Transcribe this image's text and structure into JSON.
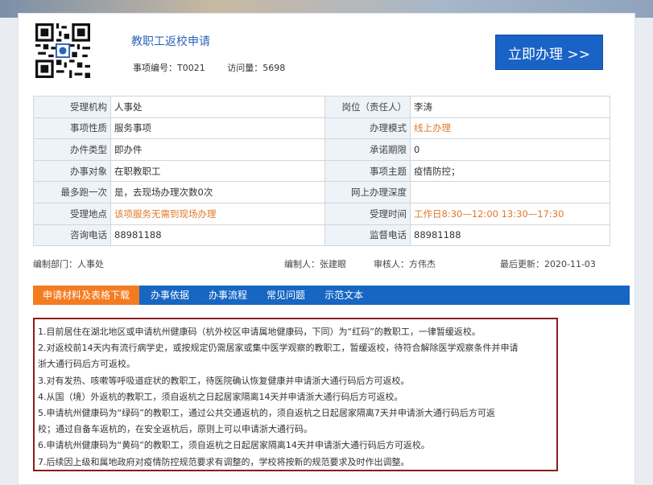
{
  "header": {
    "title": "教职工返校申请",
    "item_no": "事项编号：T0021",
    "visits": "访问量：5698",
    "apply_button": "立即办理 >>"
  },
  "colors": {
    "accent": "#1a63c6",
    "orange": "#e0792a",
    "tab_active": "#f47c20",
    "notice_border": "#8b1c1c"
  },
  "info": {
    "rows": [
      {
        "l1": "受理机构",
        "v1": "人事处",
        "l2": "岗位（责任人）",
        "v2": "李涛"
      },
      {
        "l1": "事项性质",
        "v1": "服务事项",
        "l2": "办理模式",
        "v2": "线上办理"
      },
      {
        "l1": "办件类型",
        "v1": "即办件",
        "l2": "承诺期限",
        "v2": "0"
      },
      {
        "l1": "办事对象",
        "v1": "在职教职工",
        "l2": "事项主题",
        "v2": "疫情防控；"
      },
      {
        "l1": "最多跑一次",
        "v1": "是，去现场办理次数0次",
        "l2": "网上办理深度",
        "v2": ""
      },
      {
        "l1": "受理地点",
        "v1": "该项服务无需到现场办理",
        "l2": "受理时间",
        "v2": "工作日8:30—12:00 13:30—17:30"
      },
      {
        "l1": "咨询电话",
        "v1": "88981188",
        "l2": "监督电话",
        "v2": "88981188"
      }
    ]
  },
  "footer": {
    "dept": "编制部门：人事处",
    "editor": "编制人：张建眼",
    "reviewer": "审核人：方伟杰",
    "updated": "最后更新：2020-11-03"
  },
  "tabs": [
    "申请材料及表格下载",
    "办事依据",
    "办事流程",
    "常见问题",
    "示范文本"
  ],
  "notice": [
    "1.目前居住在湖北地区或申请杭州健康码（杭外校区申请属地健康码，下同）为“红码”的教职工，一律暂缓返校。",
    "2.对返校前14天内有流行病学史，或按规定仍需居家或集中医学观察的教职工，暂缓返校，待符合解除医学观察条件并申请",
    "浙大通行码后方可返校。",
    "3.对有发热、咳嗽等呼吸道症状的教职工，待医院确认恢复健康并申请浙大通行码后方可返校。",
    "4.从国（境）外返杭的教职工，须自返杭之日起居家隔离14天并申请浙大通行码后方可返校。",
    "5.申请杭州健康码为“绿码”的教职工，通过公共交通返杭的，须自返杭之日起居家隔离7天并申请浙大通行码后方可返",
    "校；通过自备车返杭的，在安全返杭后，原则上可以申请浙大通行码。",
    "6.申请杭州健康码为“黄码”的教职工，须自返杭之日起居家隔离14天并申请浙大通行码后方可返校。",
    "7.后续因上级和属地政府对疫情防控规范要求有调整的，学校将按新的规范要求及时作出调整。"
  ]
}
